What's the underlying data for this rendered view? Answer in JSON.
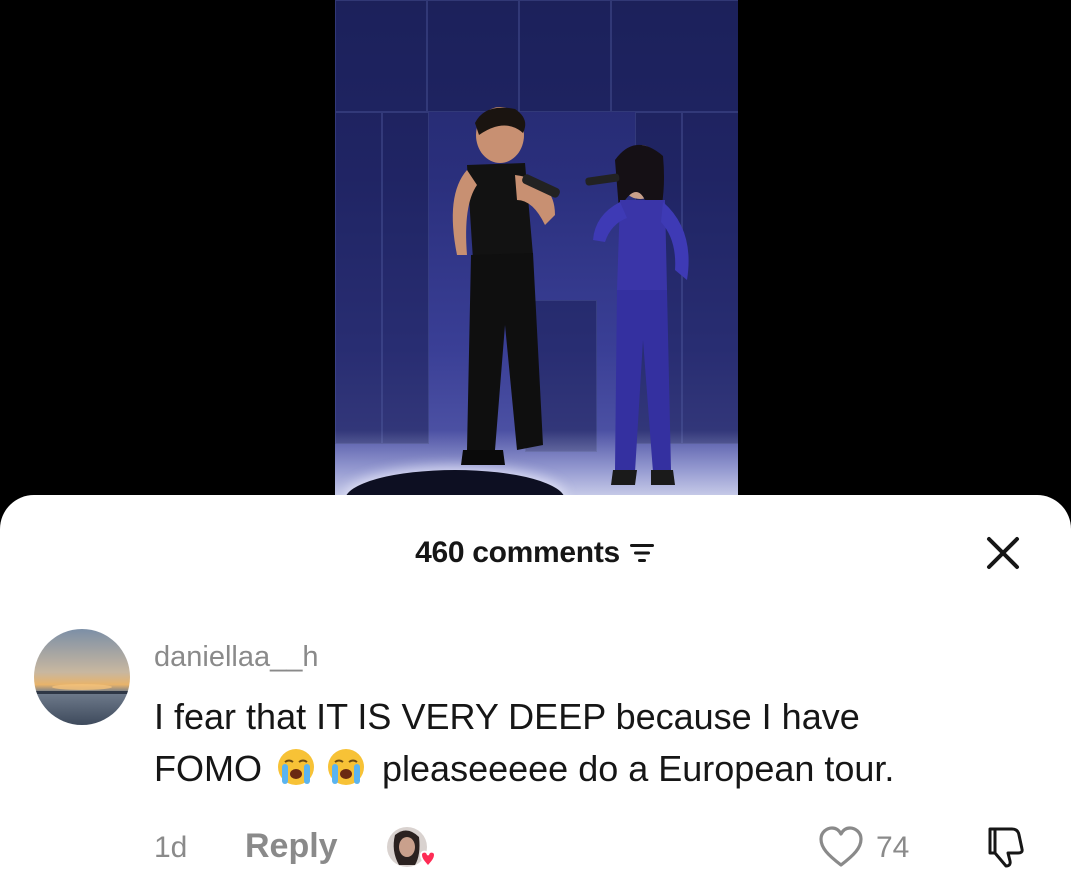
{
  "comments_header": {
    "count_label": "460 comments"
  },
  "comment": {
    "username": "daniellaa__h",
    "text_line1": "I fear that IT IS VERY DEEP because I have",
    "text_line2_start": "FOMO",
    "text_line2_end": "pleaseeeee do a European tour.",
    "time": "1d",
    "reply_label": "Reply",
    "like_count": "74"
  },
  "icons": {
    "filter": "filter-icon",
    "close": "close-icon",
    "like": "heart-outline-icon",
    "dislike": "thumbs-down-icon",
    "crying_emoji": "loudly-crying-face-emoji",
    "creator_liked": "creator-liked-badge"
  },
  "colors": {
    "text_primary": "#161616",
    "text_secondary": "#8a8a8a",
    "liked_heart": "#fe2c55"
  }
}
